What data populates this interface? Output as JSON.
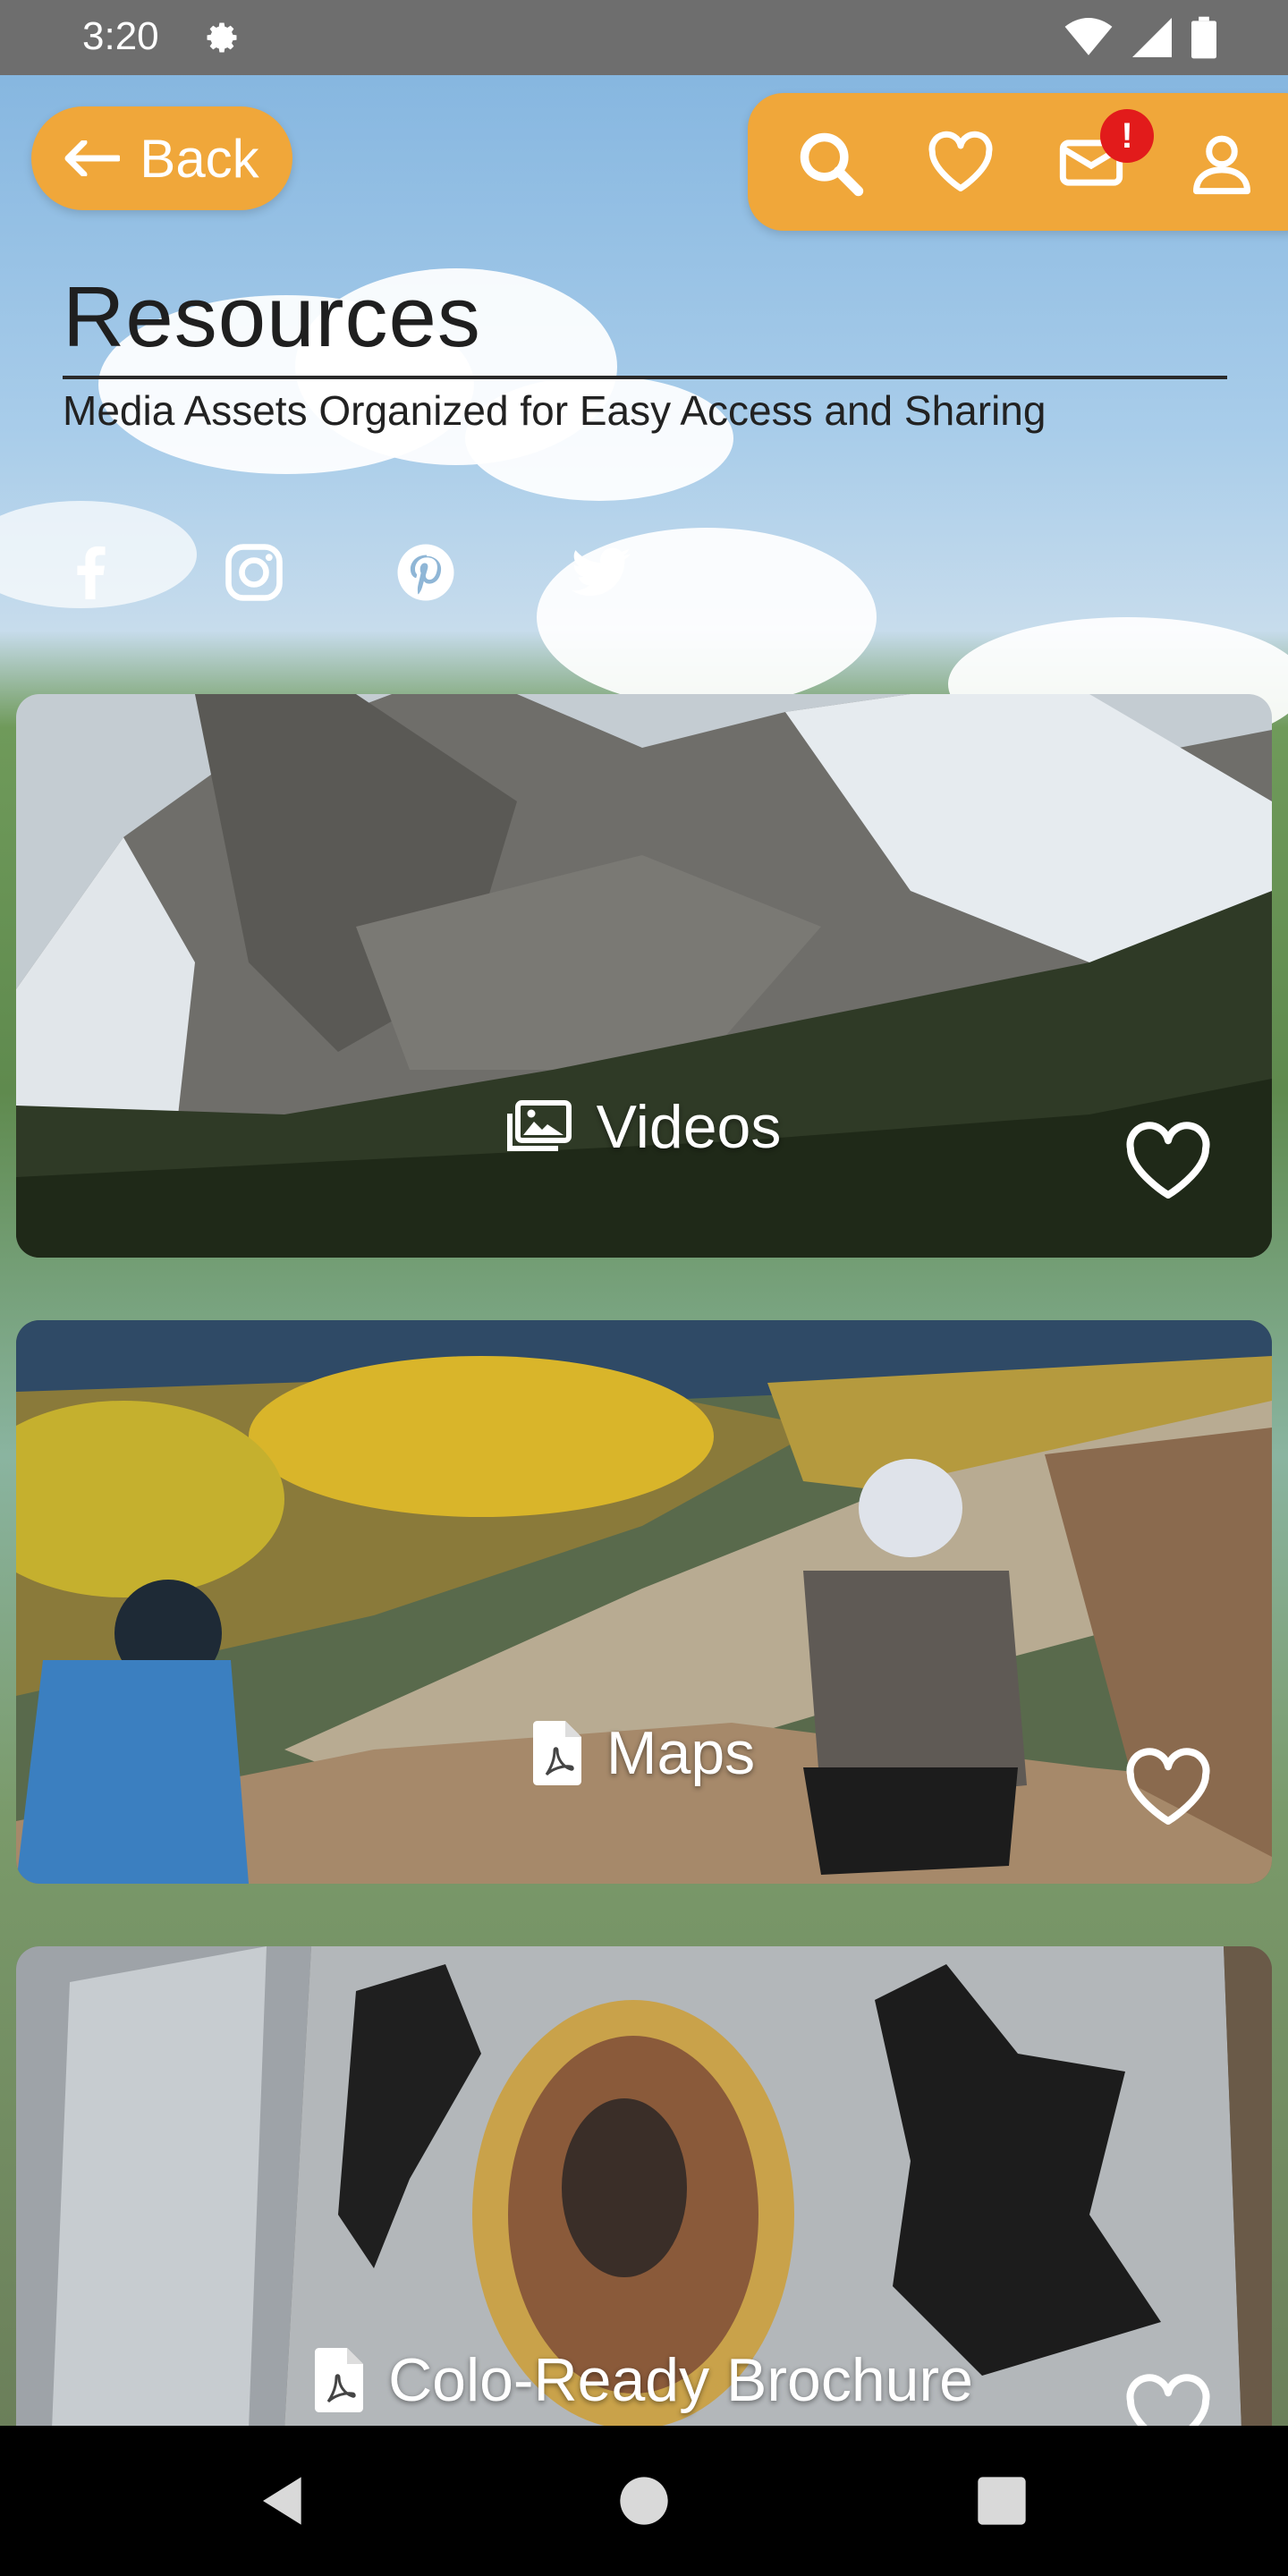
{
  "status_bar": {
    "time": "3:20",
    "icons": [
      "gear-icon",
      "wifi-icon",
      "signal-icon",
      "battery-icon"
    ]
  },
  "header": {
    "back_label": "Back",
    "actions": [
      "search-icon",
      "heart-icon",
      "mail-icon",
      "user-icon"
    ],
    "mail_badge": "!"
  },
  "page": {
    "title": "Resources",
    "subtitle": "Media Assets Organized for Easy Access and Sharing"
  },
  "social": [
    "facebook-icon",
    "instagram-icon",
    "pinterest-icon",
    "twitter-icon"
  ],
  "cards": [
    {
      "label": "Videos",
      "icon": "images-icon"
    },
    {
      "label": "Maps",
      "icon": "pdf-file-icon"
    },
    {
      "label": "Colo-Ready Brochure",
      "icon": "pdf-file-icon"
    }
  ],
  "nav": [
    "back-triangle-icon",
    "home-circle-icon",
    "recents-square-icon"
  ],
  "colors": {
    "accent": "#f0a73a",
    "badge": "#e21b1b",
    "status_bar": "#6e6e6e",
    "nav_bar": "#000000"
  }
}
